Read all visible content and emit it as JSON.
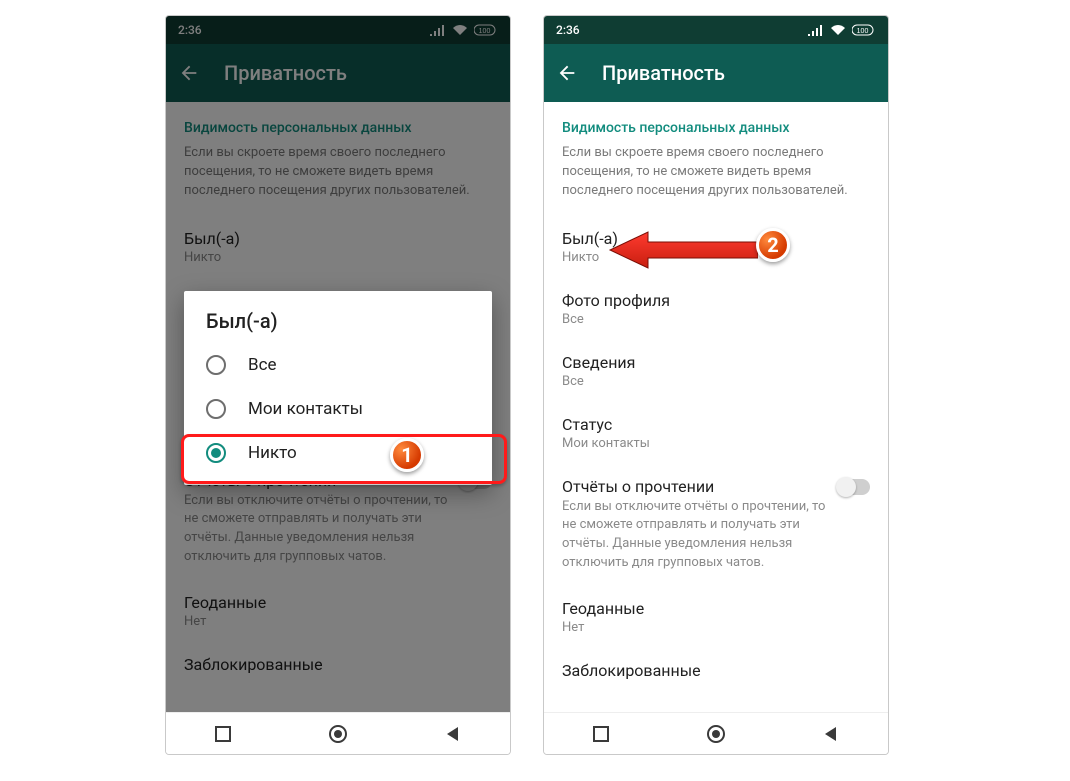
{
  "statusbar": {
    "time": "2:36",
    "battery": "100"
  },
  "header": {
    "title": "Приватность"
  },
  "section": {
    "title": "Видимость персональных данных",
    "desc": "Если вы скроете время своего последнего посещения, то не сможете видеть время последнего посещения других пользователей."
  },
  "settings": {
    "last_seen": {
      "label": "Был(-а)",
      "value": "Никто"
    },
    "photo": {
      "label": "Фото профиля",
      "value": "Все"
    },
    "about": {
      "label": "Сведения",
      "value": "Все"
    },
    "status": {
      "label": "Статус",
      "value": "Мои контакты"
    },
    "read": {
      "label": "Отчёты о прочтении",
      "desc": "Если вы отключите отчёты о прочтении, то не сможете отправлять и получать эти отчёты. Данные уведомления нельзя отключить для групповых чатов."
    },
    "geo": {
      "label": "Геоданные",
      "value": "Нет"
    },
    "blocked": {
      "label": "Заблокированные"
    }
  },
  "dialog": {
    "title": "Был(-а)",
    "options": {
      "all": "Все",
      "contacts": "Мои контакты",
      "nobody": "Никто"
    }
  },
  "markers": {
    "one": "1",
    "two": "2"
  }
}
